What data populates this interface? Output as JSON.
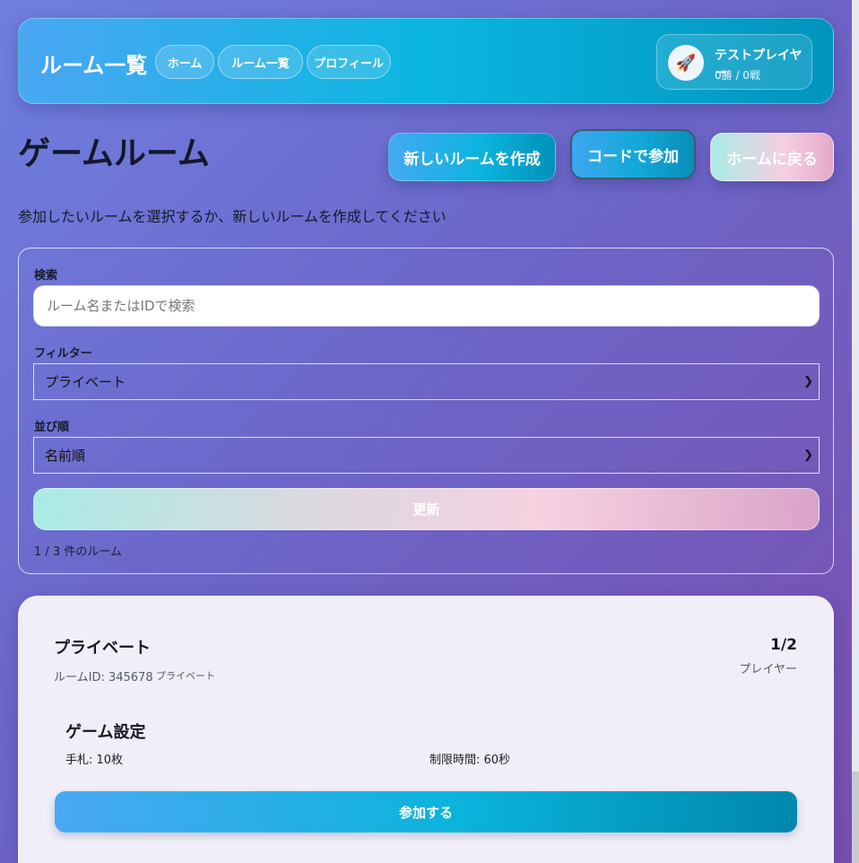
{
  "header": {
    "title": "ルーム一覧",
    "nav": [
      {
        "label": "ホーム"
      },
      {
        "label": "ルーム一覧"
      },
      {
        "label": "プロフィール"
      }
    ],
    "user": {
      "avatar_icon": "rocket-icon",
      "avatar_glyph": "🚀",
      "name": "テストプレイヤー",
      "record": "0勝 / 0戦"
    }
  },
  "page": {
    "title": "ゲームルーム",
    "subtitle": "参加したいルームを選択するか、新しいルームを作成してください",
    "actions": {
      "create": "新しいルームを作成",
      "join_code": "コードで参加",
      "home": "ホームに戻る"
    }
  },
  "search": {
    "search_label": "検索",
    "search_placeholder": "ルーム名またはIDで検索",
    "search_value": "",
    "filter_label": "フィルター",
    "filter_value": "プライベート",
    "sort_label": "並び順",
    "sort_value": "名前順",
    "refresh_label": "更新",
    "count_text": "1 / 3 件のルーム"
  },
  "rooms": [
    {
      "name": "プライベート",
      "id_text": "ルームID: 345678",
      "type": "プライベート",
      "players": "1/2",
      "players_label": "プレイヤー",
      "settings_title": "ゲーム設定",
      "hand": "手札: 10枚",
      "time_limit": "制限時間: 60秒",
      "join_label": "参加する"
    }
  ],
  "colors": {
    "accent": "#0bb6e0",
    "background_start": "#6f7fdf",
    "background_end": "#7a4fae",
    "card": "#f0eef8"
  }
}
